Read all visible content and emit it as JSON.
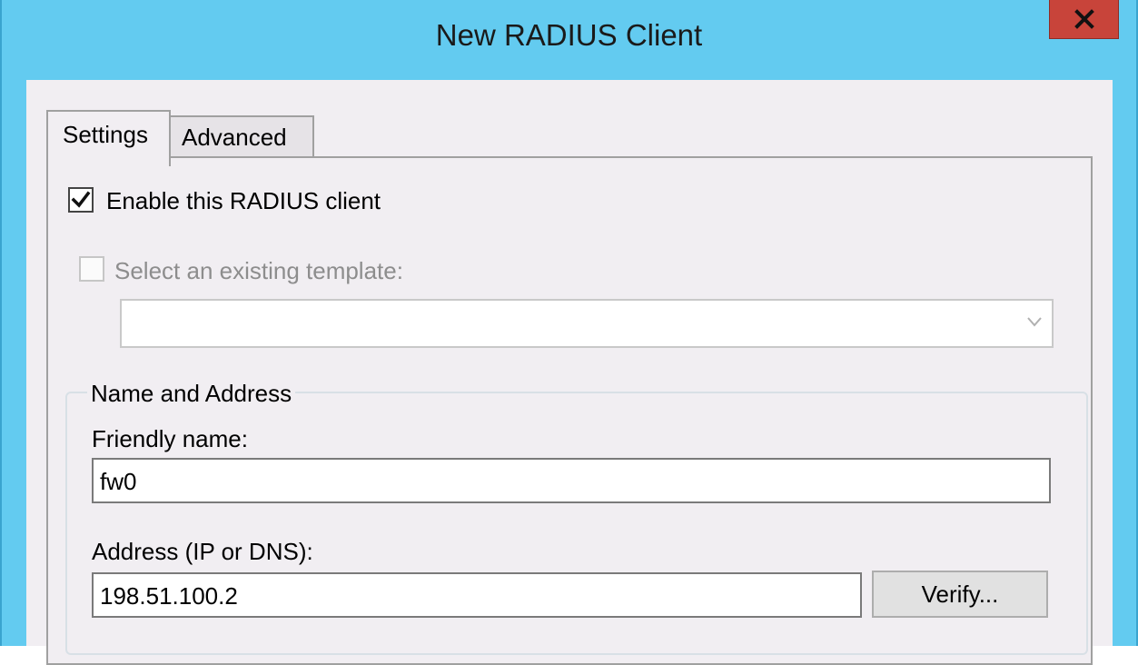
{
  "window": {
    "title": "New RADIUS Client",
    "close_glyph": "x"
  },
  "tabs": [
    {
      "label": "Settings",
      "active": true
    },
    {
      "label": "Advanced",
      "active": false
    }
  ],
  "settings": {
    "enable_client": {
      "label": "Enable this RADIUS client",
      "checked": true
    },
    "existing_template": {
      "label": "Select an existing template:",
      "checked": false,
      "disabled": true
    },
    "template_combo": {
      "value": "",
      "disabled": true
    }
  },
  "name_and_address": {
    "group_title": "Name and Address",
    "friendly_name_label": "Friendly name:",
    "friendly_name_value": "fw0",
    "address_label": "Address (IP or DNS):",
    "address_value": "198.51.100.2",
    "verify_button": "Verify..."
  },
  "colors": {
    "titlebar": "#63cbf0",
    "close_button": "#c8443a",
    "dialog_background": "#f1eef2"
  },
  "icons": {
    "close": "close-icon",
    "checkmark": "checkmark-icon",
    "dropdown": "chevron-down-icon"
  }
}
